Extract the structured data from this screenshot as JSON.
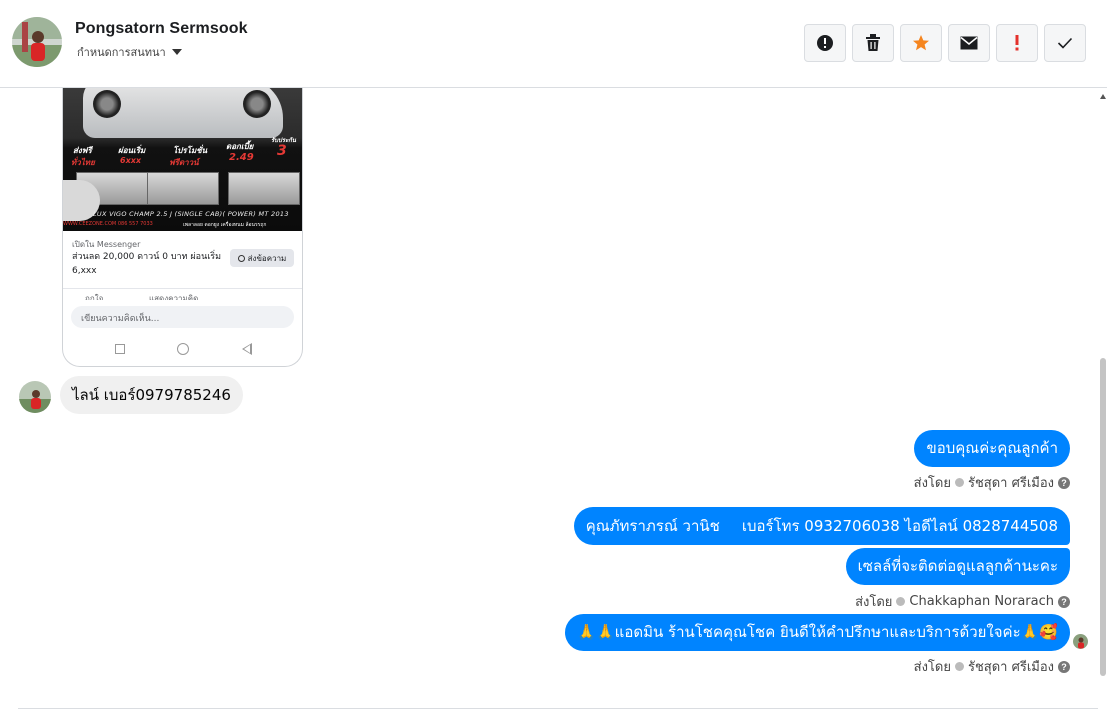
{
  "header": {
    "contact_name": "Pongsatorn Sermsook",
    "thread_menu_label": "กำหนดการสนทนา",
    "toolbar": [
      {
        "name": "report-spam-button",
        "icon": "alert-circle-icon"
      },
      {
        "name": "delete-button",
        "icon": "trash-icon"
      },
      {
        "name": "star-button",
        "icon": "star-icon"
      },
      {
        "name": "mark-unread-button",
        "icon": "envelope-icon"
      },
      {
        "name": "important-button",
        "icon": "exclamation-icon"
      },
      {
        "name": "mark-done-button",
        "icon": "checkmark-icon"
      }
    ]
  },
  "attachment": {
    "ad_tags": [
      "ส่งฟรี",
      "ทั่วไทย",
      "ผ่อนเริ่ม",
      "6xxx",
      "โปรโมชั่น",
      "ฟรีดาวน์",
      "ดอกเบี้ย",
      "2.49",
      "รับประกัน",
      "3"
    ],
    "model_text": "LUX VIGO CHAMP 2.5 J (SINGLE CAB)( POWER) MT 2013",
    "contact_line": "WWW.CEEZONE.COM  086 557 7033",
    "contact_line_2": "เพลาลอย ดอกยูง เครื่องหนม ล้อนรรถุก",
    "messenger_caption": "เปิดใน Messenger",
    "headline": "ส่วนลด 20,000 ดาวน์ 0 บาท ผ่อนเริ่ม 6,xxx",
    "send_button": "ส่งข้อความ",
    "like_label": "ถูกใจ",
    "comment_label": "แสดงความคิด",
    "comment_placeholder": "เขียนความคิดเห็น..."
  },
  "messages": {
    "incoming_1": "ไลน์ เบอร์0979785246",
    "outgoing_1": "ขอบคุณค่ะคุณลูกค้า",
    "outgoing_2a": "คุณภัทราภรณ์  วานิช",
    "outgoing_2b": "เบอร์โทร 0932706038  ไอดีไลน์ 0828744508",
    "outgoing_3": "เซลล์ที่จะติดต่อดูแลลูกค้านะคะ",
    "outgoing_4": "🙏🙏แอดมิน ร้านโชคคุณโชค ยินดีให้คำปรึกษาและบริการด้วยใจค่ะ🙏🥰"
  },
  "sent_by": [
    {
      "prefix": "ส่งโดย",
      "name": "รัชสุดา ศรีเมือง",
      "help": "?"
    },
    {
      "prefix": "ส่งโดย",
      "name": "Chakkaphan Norarach",
      "help": "?"
    },
    {
      "prefix": "ส่งโดย",
      "name": "รัชสุดา ศรีเมือง",
      "help": "?"
    }
  ],
  "colors": {
    "bubble_out": "#0084ff",
    "bubble_in": "#f0f0f0",
    "star": "#f5851f",
    "important": "#e4312c"
  }
}
